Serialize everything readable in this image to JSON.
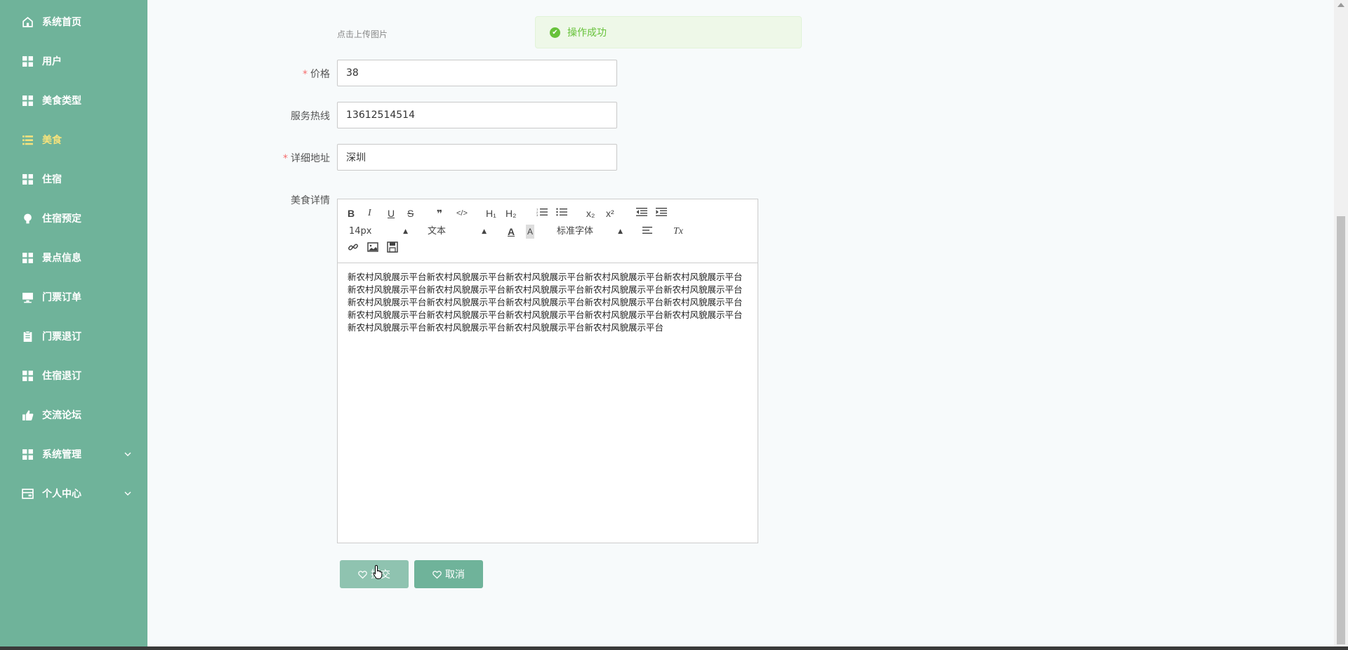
{
  "sidebar": {
    "items": [
      {
        "label": "系统首页",
        "icon": "home-icon"
      },
      {
        "label": "用户",
        "icon": "grid-icon"
      },
      {
        "label": "美食类型",
        "icon": "grid-icon"
      },
      {
        "label": "美食",
        "icon": "list-icon",
        "active": true
      },
      {
        "label": "住宿",
        "icon": "grid-icon"
      },
      {
        "label": "住宿预定",
        "icon": "bulb-icon"
      },
      {
        "label": "景点信息",
        "icon": "grid-icon"
      },
      {
        "label": "门票订单",
        "icon": "monitor-icon"
      },
      {
        "label": "门票退订",
        "icon": "clipboard-icon"
      },
      {
        "label": "住宿退订",
        "icon": "grid-icon"
      },
      {
        "label": "交流论坛",
        "icon": "thumb-icon"
      },
      {
        "label": "系统管理",
        "icon": "grid-icon",
        "expandable": true
      },
      {
        "label": "个人中心",
        "icon": "card-icon",
        "expandable": true
      }
    ],
    "colors": {
      "bg": "#6fb39a",
      "active": "#f6e27c"
    }
  },
  "form": {
    "upload_hint": "点击上传图片",
    "price": {
      "label": "价格",
      "required": true,
      "value": "38"
    },
    "hotline": {
      "label": "服务热线",
      "required": false,
      "value": "13612514514"
    },
    "address": {
      "label": "详细地址",
      "required": true,
      "value": "深圳"
    },
    "details": {
      "label": "美食详情"
    }
  },
  "toast": {
    "text": "操作成功",
    "color": "#67c23a"
  },
  "editor": {
    "toolbar": {
      "bold": "B",
      "italic": "I",
      "underline": "U",
      "strike": "S",
      "quote": "❞",
      "code": "</>",
      "h1": "H₁",
      "h2": "H₂",
      "ordered_list": "ordered-list-icon",
      "bullet_list": "bullet-list-icon",
      "sub": "x₂",
      "sup": "x²",
      "outdent": "outdent-icon",
      "indent": "indent-icon",
      "size": "14px",
      "header": "文本",
      "font": "标准字体",
      "color": "A",
      "bg": "A",
      "align": "align-icon",
      "clean": "Tx",
      "link": "link-icon",
      "image": "image-icon",
      "video": "video-icon"
    },
    "content": "新农村风貌展示平台新农村风貌展示平台新农村风貌展示平台新农村风貌展示平台新农村风貌展示平台新农村风貌展示平台新农村风貌展示平台新农村风貌展示平台新农村风貌展示平台新农村风貌展示平台新农村风貌展示平台新农村风貌展示平台新农村风貌展示平台新农村风貌展示平台新农村风貌展示平台新农村风貌展示平台新农村风貌展示平台新农村风貌展示平台新农村风貌展示平台新农村风貌展示平台新农村风貌展示平台新农村风貌展示平台新农村风貌展示平台新农村风貌展示平台"
  },
  "buttons": {
    "submit": "提交",
    "cancel": "取消"
  }
}
